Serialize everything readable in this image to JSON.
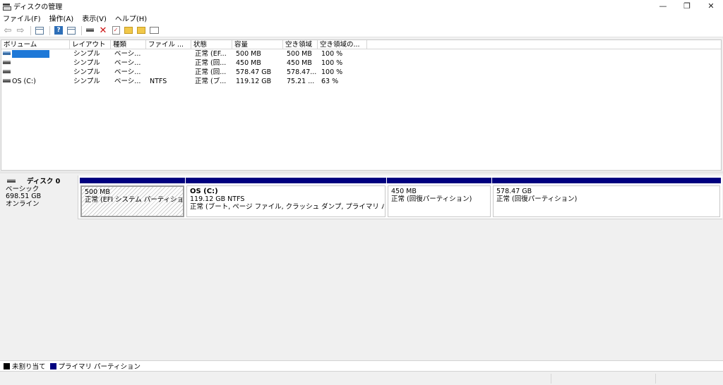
{
  "window": {
    "title": "ディスクの管理",
    "minimize": "—",
    "restore": "❐",
    "close": "✕"
  },
  "menu": [
    "ファイル(F)",
    "操作(A)",
    "表示(V)",
    "ヘルプ(H)"
  ],
  "toolbar": {
    "icons": [
      "back-arrow-icon",
      "forward-arrow-icon",
      "console-tree-icon",
      "help-icon",
      "properties-icon",
      "connect-drive-icon",
      "delete-icon",
      "check-icon",
      "new-folder-icon",
      "open-folder-icon",
      "settings-icon"
    ],
    "help_glyph": "?",
    "delete_glyph": "✕",
    "check_glyph": "✓",
    "back_glyph": "⇦",
    "forward_glyph": "⇨"
  },
  "volumes": {
    "columns": [
      "ボリューム",
      "レイアウト",
      "種類",
      "ファイル ...",
      "状態",
      "容量",
      "空き領域",
      "空き領域の..."
    ],
    "rows": [
      {
        "volume": "",
        "layout": "シンプル",
        "type": "ベーシ...",
        "fs": "",
        "status": "正常 (EF...",
        "capacity": "500 MB",
        "free": "500 MB",
        "pct": "100 %",
        "selected": true
      },
      {
        "volume": "",
        "layout": "シンプル",
        "type": "ベーシ...",
        "fs": "",
        "status": "正常 (回...",
        "capacity": "450 MB",
        "free": "450 MB",
        "pct": "100 %",
        "selected": false
      },
      {
        "volume": "",
        "layout": "シンプル",
        "type": "ベーシ...",
        "fs": "",
        "status": "正常 (回...",
        "capacity": "578.47 GB",
        "free": "578.47...",
        "pct": "100 %",
        "selected": false
      },
      {
        "volume": "OS (C:)",
        "layout": "シンプル",
        "type": "ベーシ...",
        "fs": "NTFS",
        "status": "正常 (ブ...",
        "capacity": "119.12 GB",
        "free": "75.21 ...",
        "pct": "63 %",
        "selected": false
      }
    ]
  },
  "disk": {
    "name": "ディスク 0",
    "type": "ベーシック",
    "size": "698.51 GB",
    "state": "オンライン",
    "partitions": [
      {
        "name": "",
        "size": "500 MB",
        "desc": "正常 (EFI システム パーティション)"
      },
      {
        "name": "OS (C:)",
        "size": "119.12 GB NTFS",
        "desc": "正常 (ブート, ページ ファイル, クラッシュ ダンプ, プライマリ パーティション)"
      },
      {
        "name": "",
        "size": "450 MB",
        "desc": "正常 (回復パーティション)"
      },
      {
        "name": "",
        "size": "578.47 GB",
        "desc": "正常 (回復パーティション)"
      }
    ]
  },
  "legend": [
    {
      "label": "未割り当て",
      "color": "#000000"
    },
    {
      "label": "プライマリ パーティション",
      "color": "#00007f"
    }
  ]
}
